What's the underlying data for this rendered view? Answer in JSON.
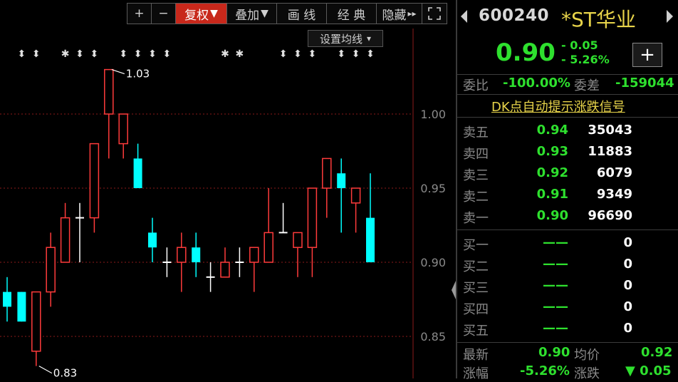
{
  "toolbar": {
    "zoom_in": "+",
    "zoom_out": "−",
    "adjust": "复权",
    "adjust_arrow": "▼",
    "overlay": "叠加",
    "overlay_arrow": "▼",
    "draw_line": "画 线",
    "classic": "经 典",
    "hide": "隐藏",
    "hide_arrow": "▸▸",
    "fullscreen_icon": "fullscreen-icon"
  },
  "ma_button": {
    "label": "设置均线",
    "arrow": "▾"
  },
  "chart_data": {
    "type": "candlestick",
    "ylim": [
      0.81,
      1.05
    ],
    "yticks": [
      0.85,
      0.9,
      0.95,
      1.0
    ],
    "ytick_labels": [
      "0.85",
      "0.90",
      "0.95",
      "1.00"
    ],
    "annotations": [
      {
        "text": "1.03",
        "x_index": 7,
        "value": 1.03
      },
      {
        "text": "0.83",
        "x_index": 2,
        "value": 0.83
      }
    ],
    "signal_marks": [
      {
        "x_index": 1,
        "glyph": "⬍"
      },
      {
        "x_index": 2,
        "glyph": "⬍"
      },
      {
        "x_index": 4,
        "glyph": "✱"
      },
      {
        "x_index": 5,
        "glyph": "⬍"
      },
      {
        "x_index": 6,
        "glyph": "⬍"
      },
      {
        "x_index": 8,
        "glyph": "⬍"
      },
      {
        "x_index": 9,
        "glyph": "⬍"
      },
      {
        "x_index": 10,
        "glyph": "⬍"
      },
      {
        "x_index": 11,
        "glyph": "⬍"
      },
      {
        "x_index": 15,
        "glyph": "✱"
      },
      {
        "x_index": 16,
        "glyph": "✱"
      },
      {
        "x_index": 19,
        "glyph": "⬍"
      },
      {
        "x_index": 20,
        "glyph": "⬍"
      },
      {
        "x_index": 21,
        "glyph": "⬍"
      },
      {
        "x_index": 23,
        "glyph": "⬍"
      },
      {
        "x_index": 24,
        "glyph": "⬍"
      },
      {
        "x_index": 25,
        "glyph": "⬍"
      }
    ],
    "candles": [
      {
        "open": 0.88,
        "close": 0.87,
        "high": 0.89,
        "low": 0.86
      },
      {
        "open": 0.88,
        "close": 0.86,
        "high": 0.88,
        "low": 0.86
      },
      {
        "open": 0.84,
        "close": 0.88,
        "high": 0.88,
        "low": 0.83
      },
      {
        "open": 0.88,
        "close": 0.91,
        "high": 0.92,
        "low": 0.87
      },
      {
        "open": 0.9,
        "close": 0.93,
        "high": 0.94,
        "low": 0.9
      },
      {
        "open": 0.93,
        "close": 0.93,
        "high": 0.94,
        "low": 0.9
      },
      {
        "open": 0.93,
        "close": 0.98,
        "high": 0.98,
        "low": 0.92
      },
      {
        "open": 1.0,
        "close": 1.03,
        "high": 1.03,
        "low": 0.97
      },
      {
        "open": 0.98,
        "close": 1.0,
        "high": 1.0,
        "low": 0.97
      },
      {
        "open": 0.97,
        "close": 0.95,
        "high": 0.98,
        "low": 0.95
      },
      {
        "open": 0.92,
        "close": 0.91,
        "high": 0.93,
        "low": 0.9
      },
      {
        "open": 0.9,
        "close": 0.9,
        "high": 0.91,
        "low": 0.89
      },
      {
        "open": 0.9,
        "close": 0.91,
        "high": 0.92,
        "low": 0.88
      },
      {
        "open": 0.91,
        "close": 0.9,
        "high": 0.92,
        "low": 0.89
      },
      {
        "open": 0.89,
        "close": 0.89,
        "high": 0.9,
        "low": 0.88
      },
      {
        "open": 0.89,
        "close": 0.9,
        "high": 0.91,
        "low": 0.89
      },
      {
        "open": 0.9,
        "close": 0.9,
        "high": 0.91,
        "low": 0.89
      },
      {
        "open": 0.9,
        "close": 0.91,
        "high": 0.91,
        "low": 0.88
      },
      {
        "open": 0.9,
        "close": 0.92,
        "high": 0.95,
        "low": 0.9
      },
      {
        "open": 0.92,
        "close": 0.92,
        "high": 0.94,
        "low": 0.92
      },
      {
        "open": 0.91,
        "close": 0.92,
        "high": 0.92,
        "low": 0.89
      },
      {
        "open": 0.91,
        "close": 0.95,
        "high": 0.95,
        "low": 0.89
      },
      {
        "open": 0.95,
        "close": 0.97,
        "high": 0.97,
        "low": 0.93
      },
      {
        "open": 0.96,
        "close": 0.95,
        "high": 0.97,
        "low": 0.92
      },
      {
        "open": 0.94,
        "close": 0.95,
        "high": 0.95,
        "low": 0.92
      },
      {
        "open": 0.93,
        "close": 0.9,
        "high": 0.96,
        "low": 0.9
      }
    ],
    "colors": {
      "up": "#ff3b3b",
      "down": "#00ffff",
      "flat": "#ffffff",
      "grid": "#8b1a1a",
      "axis": "#8b1a1a",
      "tick": "#8a8a8a"
    }
  },
  "quote": {
    "code": "600240",
    "name": "*ST华业",
    "price": "0.90",
    "change": "- 0.05",
    "change_pct": "- 5.26%",
    "add_btn": "+",
    "webi_label": "委比",
    "webi_value": "-100.00%",
    "weicha_label": "委差",
    "weicha_value": "-159044",
    "dk_link": "DK点自动提示涨跌信号",
    "asks": [
      {
        "label": "卖五",
        "price": "0.94",
        "vol": "35043"
      },
      {
        "label": "卖四",
        "price": "0.93",
        "vol": "11883"
      },
      {
        "label": "卖三",
        "price": "0.92",
        "vol": "6079"
      },
      {
        "label": "卖二",
        "price": "0.91",
        "vol": "9349"
      },
      {
        "label": "卖一",
        "price": "0.90",
        "vol": "96690"
      }
    ],
    "bids": [
      {
        "label": "买一",
        "price": "——",
        "vol": "0"
      },
      {
        "label": "买二",
        "price": "——",
        "vol": "0"
      },
      {
        "label": "买三",
        "price": "——",
        "vol": "0"
      },
      {
        "label": "买四",
        "price": "——",
        "vol": "0"
      },
      {
        "label": "买五",
        "price": "——",
        "vol": "0"
      }
    ],
    "latest_label": "最新",
    "latest_value": "0.90",
    "avg_label": "均价",
    "avg_value": "0.92",
    "chgpct_label": "涨幅",
    "chgpct_value": "-5.26%",
    "chg_label": "涨跌",
    "chg_value": "▼ 0.05"
  }
}
